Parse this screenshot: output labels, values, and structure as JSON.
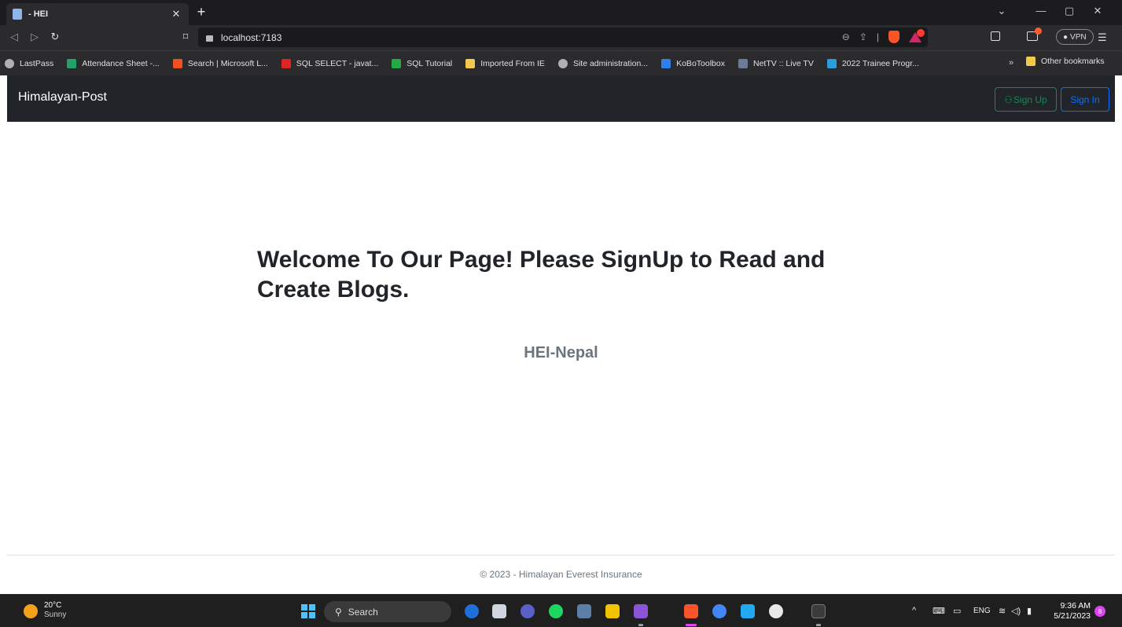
{
  "browser": {
    "tab_title": "- HEI",
    "url": "localhost:7183",
    "vpn_label": "VPN",
    "bookmarks": [
      {
        "label": "LastPass",
        "color": "#b0b0b0"
      },
      {
        "label": "Attendance Sheet -...",
        "color": "#21a366"
      },
      {
        "label": "Search | Microsoft L...",
        "color": "#f25022"
      },
      {
        "label": "SQL SELECT - javat...",
        "color": "#e02424"
      },
      {
        "label": "SQL Tutorial",
        "color": "#28a745"
      },
      {
        "label": "Imported From IE",
        "color": "#f2c94c"
      },
      {
        "label": "Site administration...",
        "color": "#b0b0b0"
      },
      {
        "label": "KoBoToolbox",
        "color": "#2f80ed"
      },
      {
        "label": "NetTV :: Live TV",
        "color": "#6b7a99"
      },
      {
        "label": "2022 Trainee Progr...",
        "color": "#2d9cdb"
      }
    ],
    "more_bookmarks": "»",
    "other_bookmarks": "Other bookmarks"
  },
  "app": {
    "brand": "Himalayan-Post",
    "signup_label": "Sign Up",
    "signin_label": "Sign In",
    "hero_title": "Welcome To Our Page! Please SignUp to Read and Create Blogs.",
    "hero_subtitle": "HEI-Nepal",
    "footer": "© 2023 - Himalayan Everest Insurance"
  },
  "taskbar": {
    "temperature": "20°C",
    "weather": "Sunny",
    "search_label": "Search",
    "language": "ENG",
    "time": "9:36 AM",
    "date": "5/21/2023",
    "notification_count": "8"
  },
  "colors": {
    "navbar_bg": "#212529",
    "signup_green": "#198754",
    "signin_blue": "#0d6efd"
  }
}
